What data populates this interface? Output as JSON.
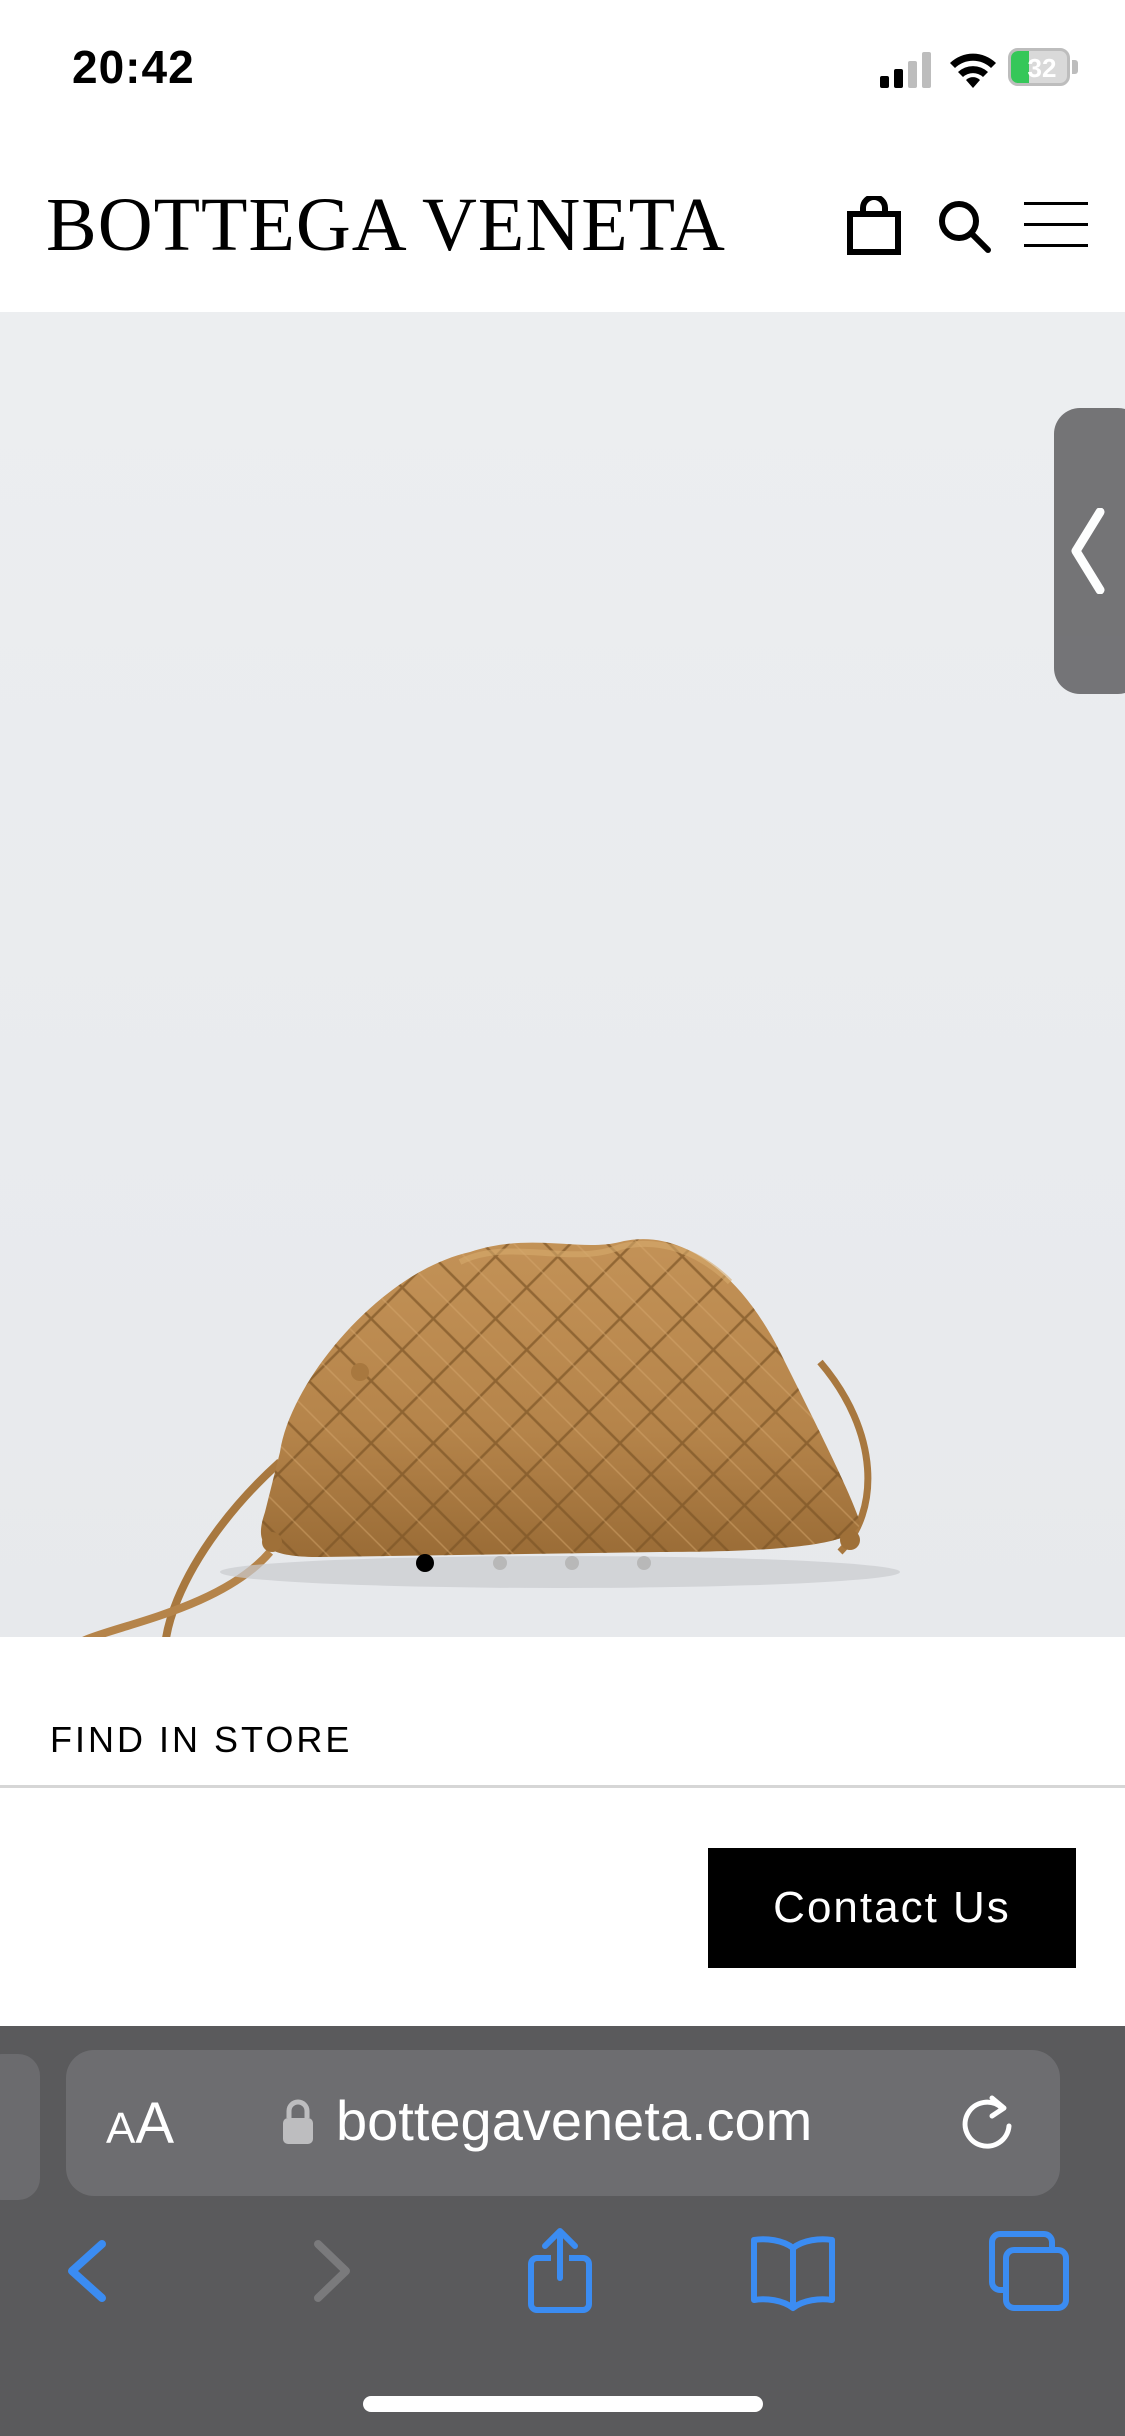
{
  "status_bar": {
    "time": "20:42",
    "battery_percent": "32",
    "battery_level": 0.32
  },
  "header": {
    "brand": "BOTTEGA VENETA",
    "icons": [
      "bag-icon",
      "search-icon",
      "menu-icon"
    ]
  },
  "gallery": {
    "image_count": 4,
    "active_index": 0,
    "side_handle_icon": "chevron-left-icon"
  },
  "find_in_store": {
    "label": "FIND IN STORE"
  },
  "contact": {
    "button_label": "Contact Us"
  },
  "browser": {
    "text_size_label_small": "A",
    "text_size_label_large": "A",
    "url": "bottegaveneta.com",
    "toolbar_icons": [
      "back-icon",
      "forward-icon",
      "share-icon",
      "bookmarks-icon",
      "tabs-icon"
    ]
  },
  "colors": {
    "safari_accent": "#3b8cf2",
    "battery_green": "#35c759",
    "bag_leather": "#b5844a"
  }
}
